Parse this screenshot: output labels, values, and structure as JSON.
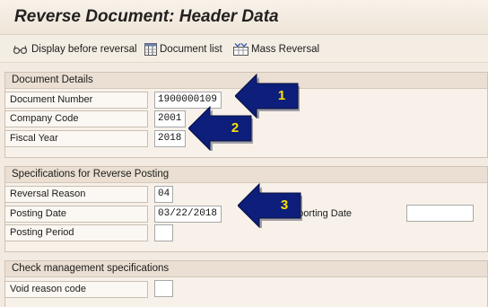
{
  "window": {
    "title": "Reverse Document: Header Data"
  },
  "toolbar": {
    "display_before_reversal": "Display before reversal",
    "document_list": "Document list",
    "mass_reversal": "Mass Reversal"
  },
  "document_details": {
    "header": "Document Details",
    "document_number_label": "Document Number",
    "document_number_value": "1900000109",
    "company_code_label": "Company Code",
    "company_code_value": "2001",
    "fiscal_year_label": "Fiscal Year",
    "fiscal_year_value": "2018"
  },
  "reverse_posting": {
    "header": "Specifications for Reverse Posting",
    "reversal_reason_label": "Reversal Reason",
    "reversal_reason_value": "04",
    "posting_date_label": "Posting Date",
    "posting_date_value": "03/22/2018",
    "reporting_date_label": "eporting Date",
    "reporting_date_value": "",
    "posting_period_label": "Posting Period",
    "posting_period_value": ""
  },
  "check_management": {
    "header": "Check management specifications",
    "void_reason_label": "Void reason code",
    "void_reason_value": ""
  },
  "callouts": [
    "1",
    "2",
    "3"
  ],
  "colors": {
    "callout_fill": "#0d1f7a",
    "callout_text": "#ffe100",
    "background": "#f3ebe1"
  }
}
